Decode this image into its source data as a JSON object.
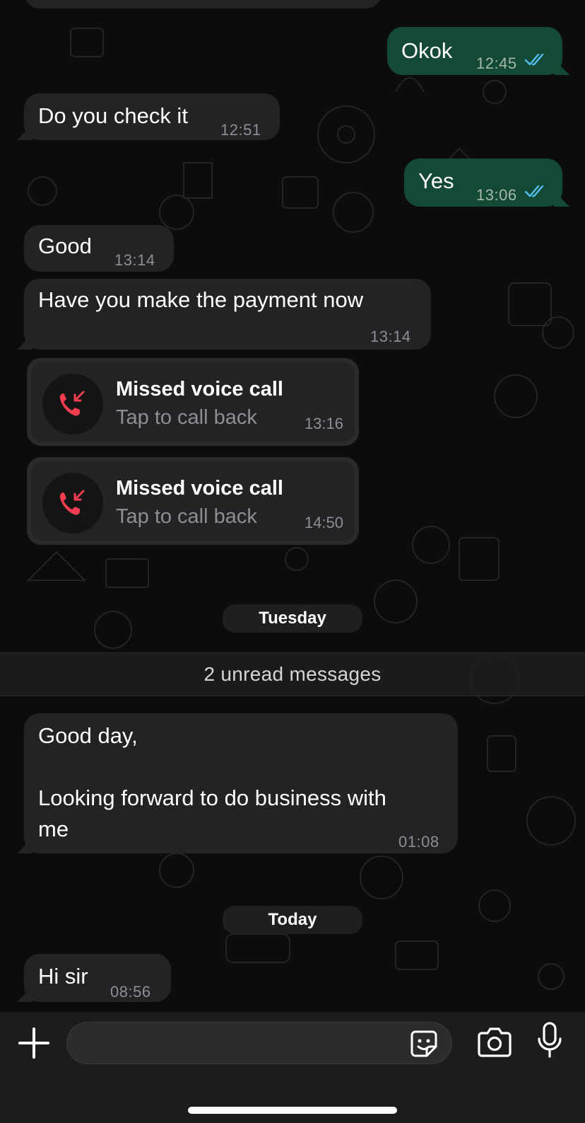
{
  "messages": {
    "okok": {
      "text": "Okok",
      "time": "12:45"
    },
    "check": {
      "text": "Do you check it",
      "time": "12:51"
    },
    "yes": {
      "text": "Yes",
      "time": "13:06"
    },
    "good": {
      "text": "Good",
      "time": "13:14"
    },
    "payment": {
      "text": "Have you make the payment now",
      "time": "13:14"
    },
    "call1": {
      "title": "Missed voice call",
      "subtitle": "Tap to call back",
      "time": "13:16"
    },
    "call2": {
      "title": "Missed voice call",
      "subtitle": "Tap to call back",
      "time": "14:50"
    },
    "business": {
      "line1": "Good day,",
      "line2": "Looking forward to do business with",
      "line3": "me",
      "time": "01:08"
    },
    "hisir": {
      "text": "Hi sir",
      "time": "08:56"
    }
  },
  "dividers": {
    "tuesday": "Tuesday",
    "unread": "2 unread messages",
    "today": "Today"
  },
  "input": {
    "placeholder": ""
  },
  "icons": {
    "add": "plus-icon",
    "sticker": "sticker-icon",
    "camera": "camera-icon",
    "mic": "microphone-icon",
    "read": "double-check-icon",
    "missed_call": "missed-call-icon"
  },
  "colors": {
    "incoming_bubble": "#232325",
    "outgoing_bubble": "#144a35",
    "read_ticks": "#53bdeb",
    "missed_call": "#f23c4f"
  }
}
